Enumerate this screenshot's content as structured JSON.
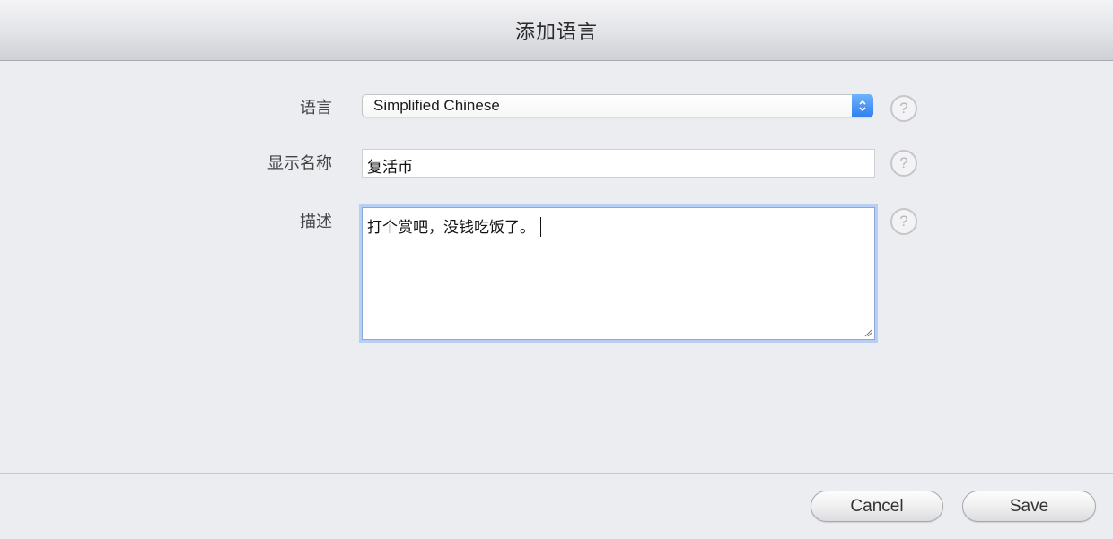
{
  "dialog": {
    "title": "添加语言"
  },
  "form": {
    "language": {
      "label": "语言",
      "selected": "Simplified Chinese"
    },
    "display_name": {
      "label": "显示名称",
      "value": "复活币"
    },
    "description": {
      "label": "描述",
      "value": "打个赏吧，没钱吃饭了。"
    },
    "help_glyph": "?"
  },
  "footer": {
    "cancel_label": "Cancel",
    "save_label": "Save"
  },
  "colors": {
    "accent": "#2f7ef3",
    "focus_ring": "#b7cff2"
  }
}
